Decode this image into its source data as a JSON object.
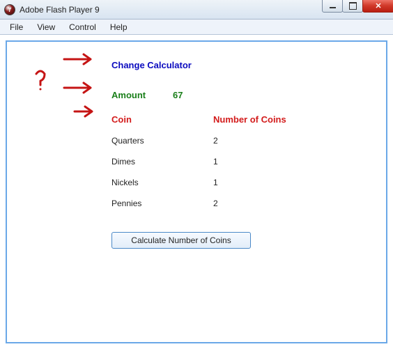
{
  "window": {
    "title": "Adobe Flash Player 9"
  },
  "menu": {
    "file": "File",
    "view": "View",
    "control": "Control",
    "help": "Help"
  },
  "app": {
    "title": "Change Calculator",
    "amountLabel": "Amount",
    "amountValue": "67",
    "coinHeader": "Coin",
    "numberHeader": "Number of Coins",
    "rows": [
      {
        "coin": "Quarters",
        "count": "2"
      },
      {
        "coin": "Dimes",
        "count": "1"
      },
      {
        "coin": "Nickels",
        "count": "1"
      },
      {
        "coin": "Pennies",
        "count": "2"
      }
    ],
    "buttonLabel": "Calculate Number of Coins"
  }
}
